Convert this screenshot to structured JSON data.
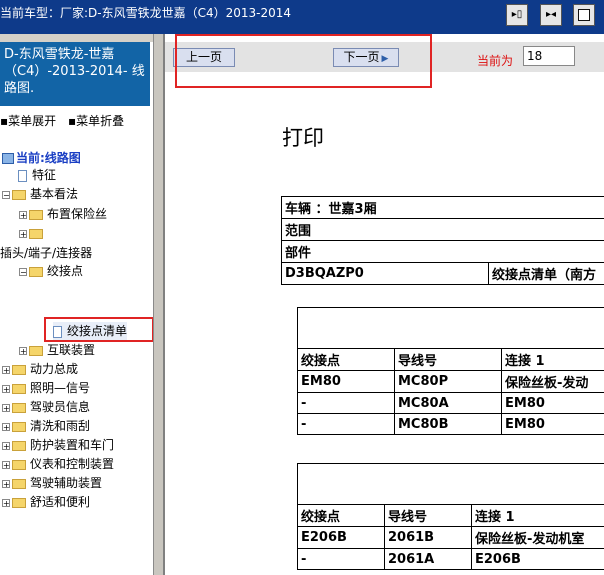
{
  "window": {
    "title": "当前车型：厂家:D-东风雪铁龙世嘉（C4）2013-2014"
  },
  "left_panel": {
    "header": [
      "D-东风雪铁龙-世嘉",
      "（C4）-2013-2014- 线",
      "路图."
    ],
    "menu": {
      "expand": "菜单展开",
      "collapse": "菜单折叠"
    },
    "tree": [
      {
        "label": "当前:线路图"
      },
      {
        "label": "特征"
      },
      {
        "label": "基本看法"
      },
      {
        "label": "布置保险丝"
      },
      {
        "label": ""
      },
      {
        "label": "插头/端子/连接器"
      },
      {
        "label": "绞接点"
      },
      {
        "label": "绞接点清单"
      },
      {
        "label": "互联装置"
      },
      {
        "label": "动力总成"
      },
      {
        "label": "照明—信号"
      },
      {
        "label": "驾驶员信息"
      },
      {
        "label": "清洗和雨刮"
      },
      {
        "label": "防护装置和车门"
      },
      {
        "label": "仪表和控制装置"
      },
      {
        "label": "驾驶辅助装置"
      },
      {
        "label": "舒适和便利"
      }
    ]
  },
  "nav": {
    "prev": "上一页",
    "next": "下一页",
    "page_label": "当前为",
    "page_value": "18"
  },
  "document": {
    "title": "打印",
    "vehicle_table": [
      "车辆 ：世嘉3厢",
      "范围",
      "部件",
      [
        "D3BQAZP0",
        "绞接点清单（南方"
      ]
    ],
    "table1": {
      "headers": [
        "绞接点",
        "导线号",
        "连接 1"
      ],
      "rows": [
        [
          "EM80",
          "MC80P",
          "保险丝板-发动"
        ],
        [
          "-",
          "MC80A",
          "EM80"
        ],
        [
          "-",
          "MC80B",
          "EM80"
        ]
      ]
    },
    "table2": {
      "headers": [
        "绞接点",
        "导线号",
        "连接 1"
      ],
      "rows": [
        [
          "E206B",
          "2061B",
          "保险丝板-发动机室"
        ],
        [
          "-",
          "2061A",
          "E206B"
        ]
      ]
    }
  },
  "colors": {
    "titlebar": "#0e3a8a",
    "left_header": "#1264a6",
    "highlight": "#e02424",
    "page_label": "#d11111"
  }
}
